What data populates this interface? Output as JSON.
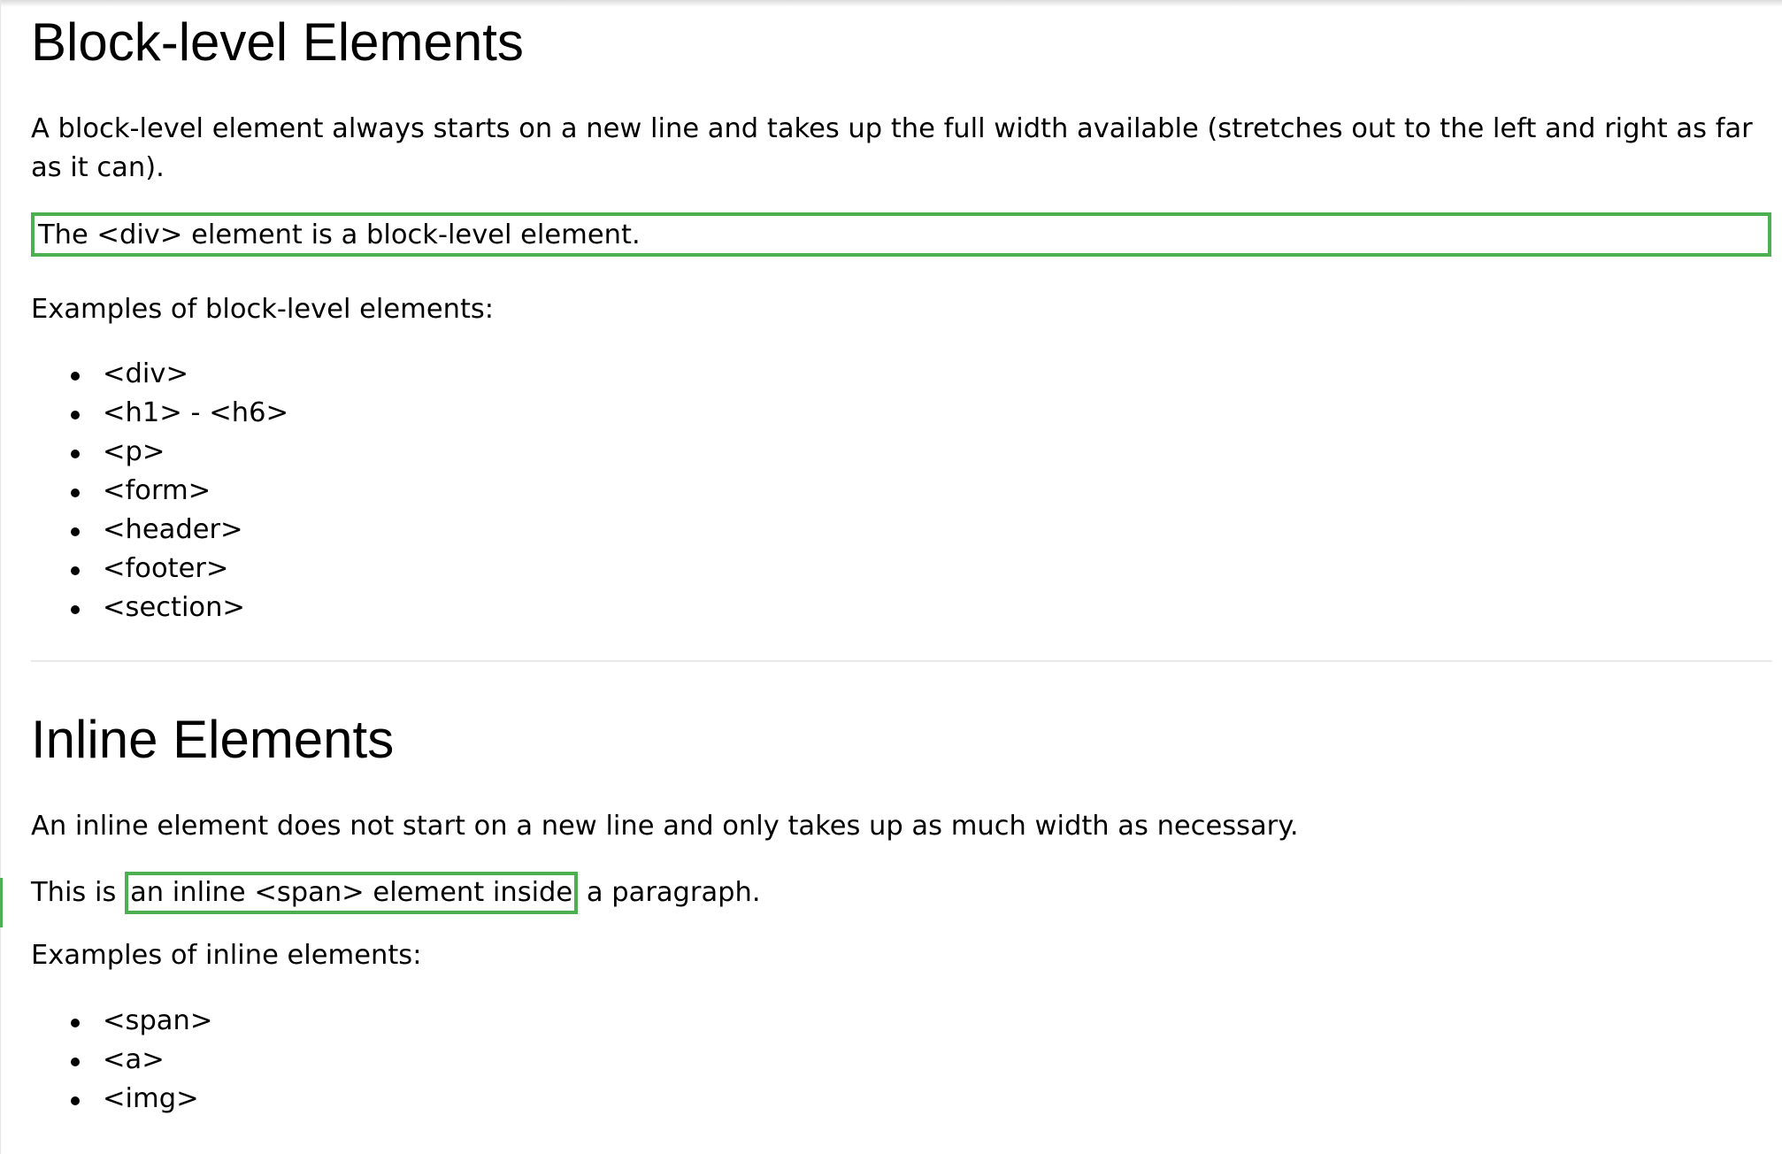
{
  "block_section": {
    "heading": "Block-level Elements",
    "description": "A block-level element always starts on a new line and takes up the full width available (stretches out to the left and right as far as it can).",
    "div_example": "The <div> element is a block-level element.",
    "examples_label": "Examples of block-level elements:",
    "examples": [
      "<div>",
      "<h1> - <h6>",
      "<p>",
      "<form>",
      "<header>",
      "<footer>",
      "<section>"
    ]
  },
  "inline_section": {
    "heading": "Inline Elements",
    "description": "An inline element does not start on a new line and only takes up as much width as necessary.",
    "span_example": {
      "before": "This is ",
      "span_text": "an inline <span> element inside",
      "after": " a paragraph."
    },
    "examples_label": "Examples of inline elements:",
    "examples": [
      "<span>",
      "<a>",
      "<img>"
    ]
  },
  "colors": {
    "highlight_border": "#4caf50",
    "divider": "#e8e8e8",
    "text": "#000000",
    "background": "#ffffff"
  }
}
